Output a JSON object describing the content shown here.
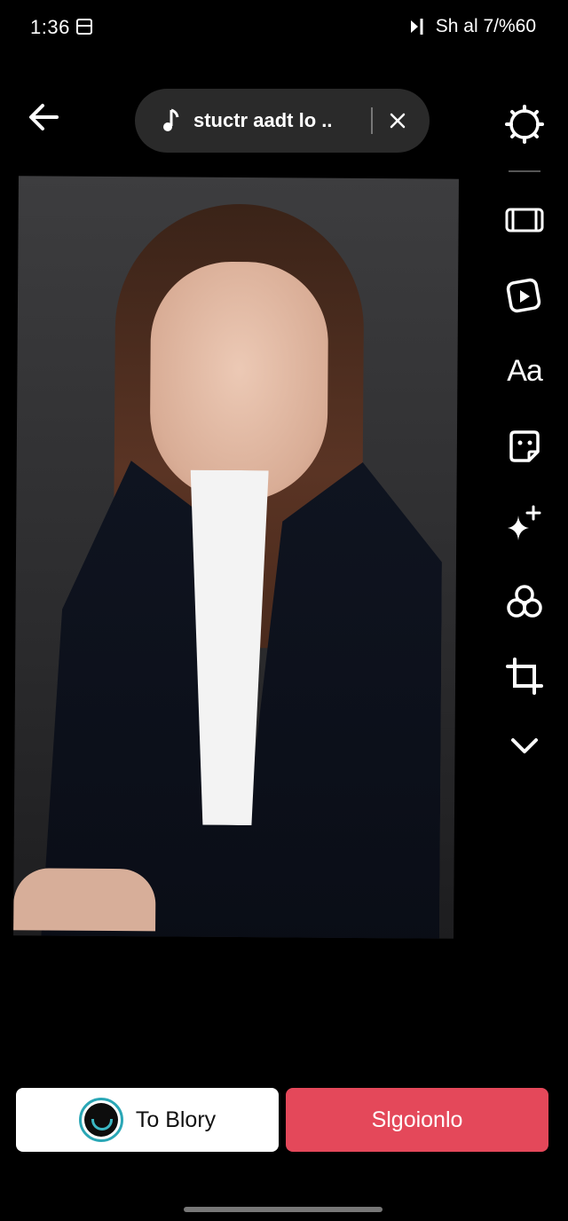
{
  "status_bar": {
    "time": "1:36",
    "right_text": "Sh al 7/%60"
  },
  "sound": {
    "title": "stuctr aadt lo .."
  },
  "side_tools": {
    "text_tool_label": "Aa"
  },
  "actions": {
    "story_label": "To Blory",
    "next_label": "Slgoionlo"
  },
  "colors": {
    "accent": "#e4485a",
    "pill_bg": "#2a2a2a",
    "avatar_ring": "#2aa7b6"
  }
}
